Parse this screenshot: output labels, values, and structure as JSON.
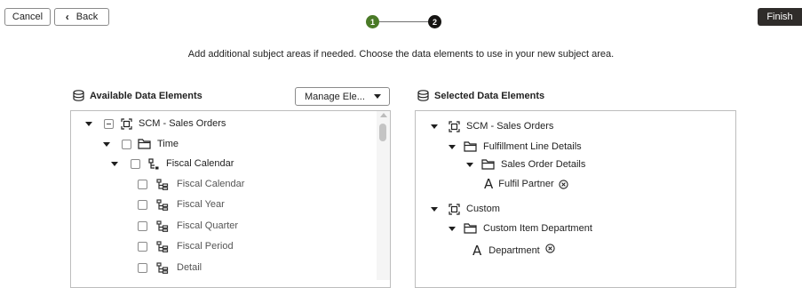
{
  "toolbar": {
    "cancel_label": "Cancel",
    "back_label": "Back",
    "finish_label": "Finish"
  },
  "stepper": {
    "steps": [
      {
        "number": "1",
        "state": "complete",
        "color": "#4a7a27"
      },
      {
        "number": "2",
        "state": "current",
        "color": "#161513"
      }
    ]
  },
  "instructions": "Add additional subject areas if needed. Choose the data elements to use in your new subject area.",
  "available_panel": {
    "title": "Available Data Elements",
    "manage_button_label": "Manage Ele...",
    "tree": [
      {
        "label": "SCM - Sales Orders",
        "icon": "subject-area-icon",
        "expanded": true,
        "checkbox": "partial"
      },
      {
        "label": "Time",
        "icon": "folder-icon",
        "expanded": true,
        "checkbox": "unchecked"
      },
      {
        "label": "Fiscal Calendar",
        "icon": "hierarchy-icon",
        "expanded": true,
        "checkbox": "unchecked"
      },
      {
        "label": "Fiscal Calendar",
        "icon": "hierarchy-level-icon",
        "checkbox": "unchecked"
      },
      {
        "label": "Fiscal Year",
        "icon": "hierarchy-level-icon",
        "checkbox": "unchecked"
      },
      {
        "label": "Fiscal Quarter",
        "icon": "hierarchy-level-icon",
        "checkbox": "unchecked"
      },
      {
        "label": "Fiscal Period",
        "icon": "hierarchy-level-icon",
        "checkbox": "unchecked"
      },
      {
        "label": "Detail",
        "icon": "hierarchy-level-icon",
        "checkbox": "unchecked"
      }
    ]
  },
  "selected_panel": {
    "title": "Selected Data Elements",
    "tree": [
      {
        "label": "SCM - Sales Orders",
        "icon": "subject-area-icon",
        "expanded": true
      },
      {
        "label": "Fulfillment Line Details",
        "icon": "folder-icon",
        "expanded": true
      },
      {
        "label": "Sales Order Details",
        "icon": "folder-icon",
        "expanded": true
      },
      {
        "label": "Fulfil Partner",
        "icon": "attribute-icon",
        "removable": true
      },
      {
        "label": "Custom",
        "icon": "subject-area-icon",
        "expanded": true
      },
      {
        "label": "Custom Item Department",
        "icon": "folder-icon",
        "expanded": true
      },
      {
        "label": "Department",
        "icon": "attribute-icon",
        "removable": true
      }
    ]
  }
}
